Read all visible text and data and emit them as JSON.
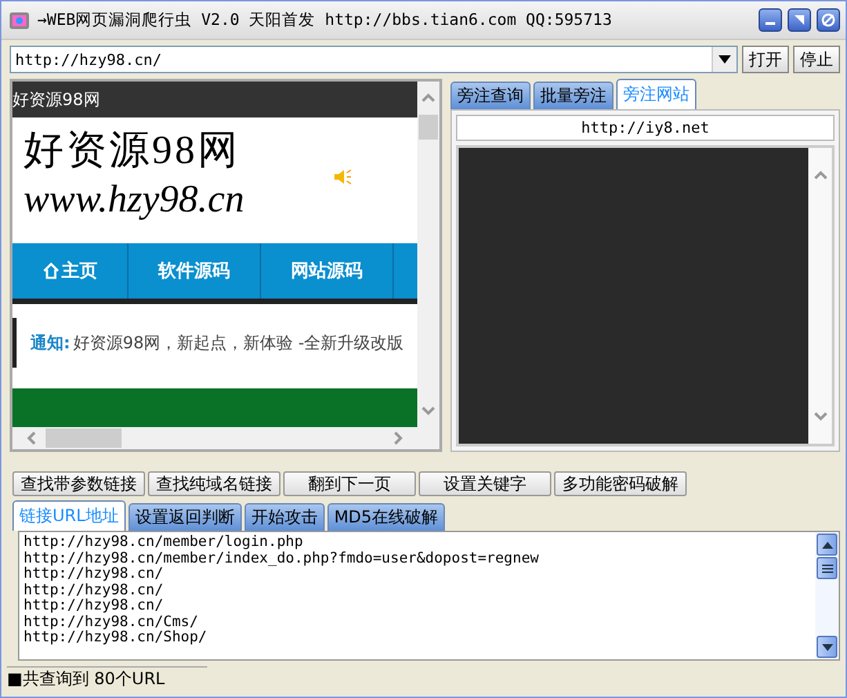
{
  "window": {
    "title": "→WEB网页漏洞爬行虫 V2.0 天阳首发 http://bbs.tian6.com    QQ:595713"
  },
  "address": {
    "value": "http://hzy98.cn/",
    "buttons": [
      "打开",
      "停止"
    ]
  },
  "browser": {
    "topbar": "好资源98网",
    "logo_title": "好资源98网",
    "logo_url": "www.hzy98.cn",
    "nav": [
      {
        "label": "主页",
        "kind": "home"
      },
      {
        "label": "软件源码",
        "kind": "plain"
      },
      {
        "label": "网站源码",
        "kind": "plain"
      }
    ],
    "notice_label": "通知:",
    "notice_text": "好资源98网，新起点，新体验 -全新升级改版"
  },
  "side_tabs": [
    {
      "label": "旁注查询",
      "selected": false
    },
    {
      "label": "批量旁注",
      "selected": false
    },
    {
      "label": "旁注网站",
      "selected": true
    }
  ],
  "side_url": "http://iy8.net",
  "actions": [
    "查找带参数链接",
    "查找纯域名链接",
    "翻到下一页",
    "设置关键字",
    "多功能密码破解"
  ],
  "tabs": [
    {
      "label": "链接URL地址",
      "selected": true
    },
    {
      "label": "设置返回判断",
      "selected": false
    },
    {
      "label": "开始攻击",
      "selected": false
    },
    {
      "label": "MD5在线破解",
      "selected": false
    }
  ],
  "urls": [
    "http://hzy98.cn/member/login.php",
    "http://hzy98.cn/member/index_do.php?fmdo=user&dopost=regnew",
    "http://hzy98.cn/",
    "http://hzy98.cn/",
    "http://hzy98.cn/",
    "http://hzy98.cn/Cms/",
    "http://hzy98.cn/Shop/"
  ],
  "status": "■共查询到 80个URL"
}
